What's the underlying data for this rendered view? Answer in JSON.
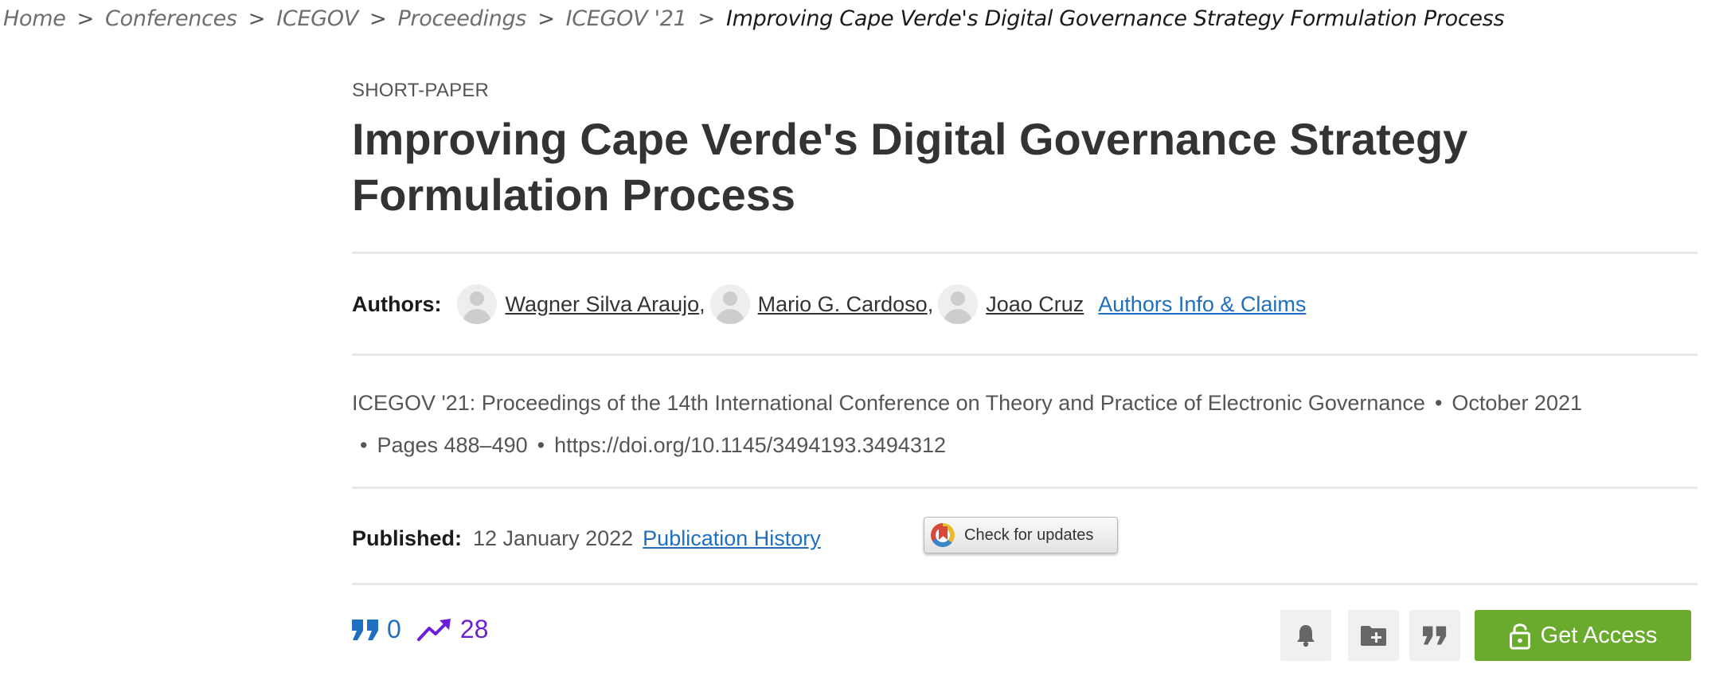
{
  "breadcrumb": {
    "items": [
      {
        "label": "Home"
      },
      {
        "label": "Conferences"
      },
      {
        "label": "ICEGOV"
      },
      {
        "label": "Proceedings"
      },
      {
        "label": "ICEGOV '21"
      }
    ],
    "current": "Improving Cape Verde's Digital Governance Strategy Formulation Process",
    "separator": ">"
  },
  "article": {
    "type": "SHORT-PAPER",
    "title": "Improving Cape Verde's Digital Governance Strategy Formulation Process"
  },
  "authors": {
    "label": "Authors:",
    "list": [
      {
        "name": "Wagner Silva Araujo",
        "sep": ","
      },
      {
        "name": "Mario G. Cardoso",
        "sep": ","
      },
      {
        "name": "Joao Cruz",
        "sep": ""
      }
    ],
    "info_link": "Authors Info & Claims"
  },
  "meta": {
    "proceedings": "ICEGOV '21: Proceedings of the 14th International Conference on Theory and Practice of Electronic Governance",
    "date": "October 2021",
    "pages": "Pages 488–490",
    "doi": "https://doi.org/10.1145/3494193.3494312",
    "bullet": "•"
  },
  "published": {
    "label": "Published:",
    "date": "12 January 2022",
    "history_link": "Publication History"
  },
  "check_updates": {
    "label": "Check for updates"
  },
  "metrics": {
    "citations": "0",
    "downloads": "28"
  },
  "actions": {
    "get_access": "Get Access",
    "icons": [
      "bell-icon",
      "add-to-folder-icon",
      "quote-icon",
      "lock-icon"
    ]
  },
  "colors": {
    "link": "#1f6fc1",
    "downloads": "#6b1fd6",
    "access_button": "#6aab2d",
    "text": "#333333",
    "muted": "#555555"
  }
}
